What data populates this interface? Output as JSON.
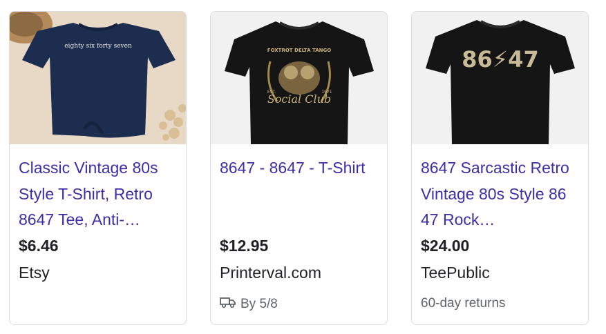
{
  "products": [
    {
      "title": "Classic Vintage 80s Style T-Shirt, Retro 8647 Tee, Anti-…",
      "price": "$6.46",
      "merchant": "Etsy",
      "image_text": "eighty six forty seven",
      "shirt_color": "#1d2d4f"
    },
    {
      "title": "8647 - 8647 - T-Shirt",
      "price": "$12.95",
      "merchant": "Printerval.com",
      "delivery": "By 5/8",
      "delivery_icon": "truck-icon",
      "image_text_top": "FOXTROT DELTA TANGO",
      "image_text_main": "Social Club",
      "image_text_left": "EST.",
      "image_text_right": "1971",
      "shirt_color": "#151515"
    },
    {
      "title": "8647 Sarcastic Retro Vintage 80s Style 86 47 Rock…",
      "price": "$24.00",
      "merchant": "TeePublic",
      "returns": "60-day returns",
      "image_text": "86⚡47",
      "shirt_color": "#151515"
    }
  ],
  "colors": {
    "title_link": "#3c2ea8",
    "text": "#202124",
    "muted": "#5f6368",
    "border": "#dadce0"
  }
}
